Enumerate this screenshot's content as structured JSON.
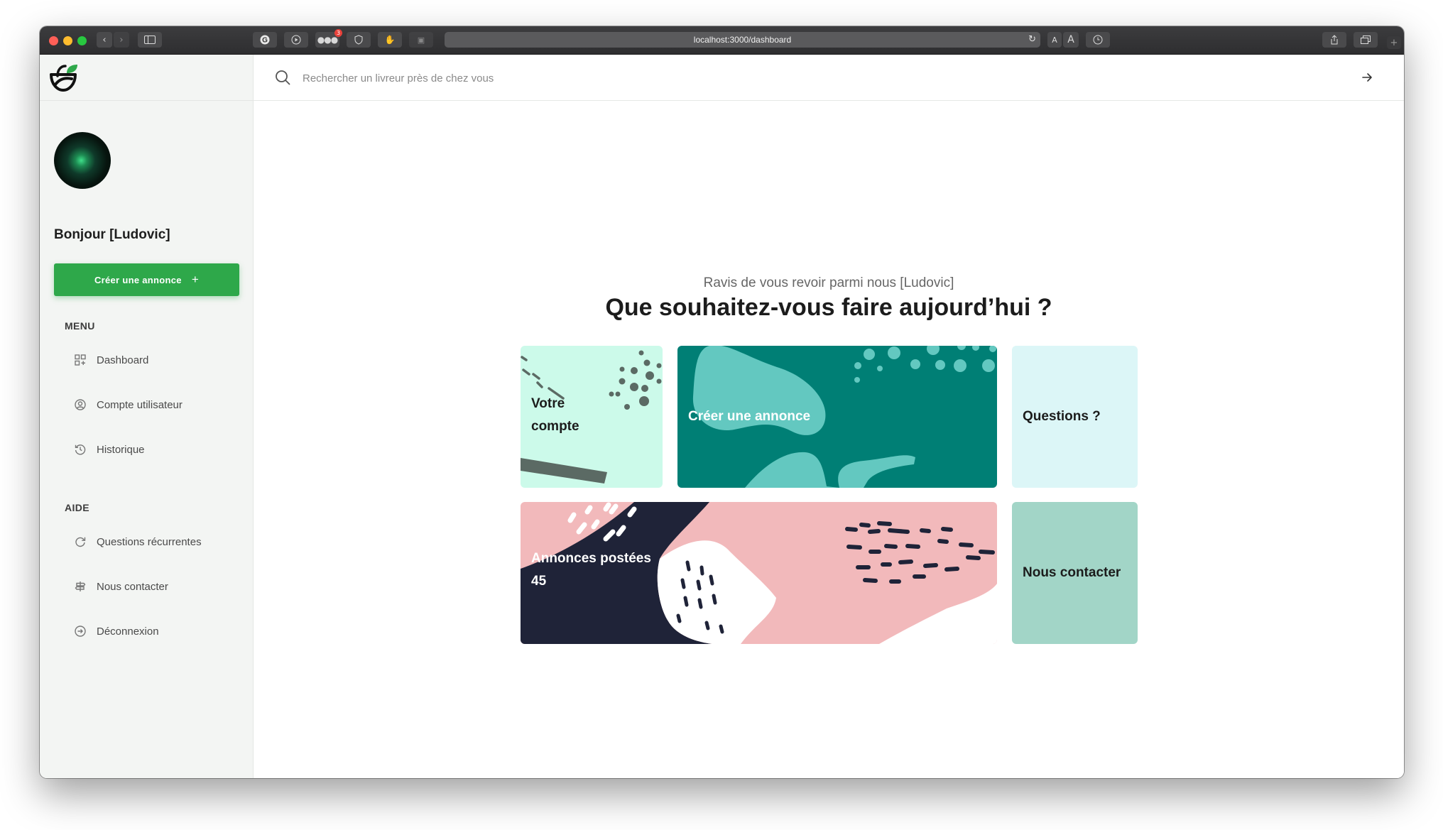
{
  "browser": {
    "url": "localhost:3000/dashboard",
    "extension_badge": "3",
    "reader_small": "A",
    "reader_large": "A"
  },
  "sidebar": {
    "greeting": "Bonjour [Ludovic]",
    "cta_label": "Créer une annonce",
    "cta_icon": "+",
    "menu_title": "MENU",
    "menu_items": [
      {
        "label": "Dashboard",
        "icon": "grid-icon"
      },
      {
        "label": "Compte utilisateur",
        "icon": "user-circle-icon"
      },
      {
        "label": "Historique",
        "icon": "history-icon"
      }
    ],
    "help_title": "AIDE",
    "help_items": [
      {
        "label": "Questions récurrentes",
        "icon": "refresh-question-icon"
      },
      {
        "label": "Nous contacter",
        "icon": "signpost-icon"
      },
      {
        "label": "Déconnexion",
        "icon": "logout-icon"
      }
    ]
  },
  "search": {
    "placeholder": "Rechercher un livreur près de chez vous"
  },
  "main": {
    "subtitle": "Ravis de vous revoir parmi nous [Ludovic]",
    "headline": "Que souhaitez-vous faire aujourd’hui ?"
  },
  "cards": {
    "account": {
      "line1": "Votre",
      "line2": "compte",
      "color": "#ccfaea"
    },
    "create": {
      "label": "Créer une annonce",
      "color": "#007f75"
    },
    "questions": {
      "label": "Questions ?",
      "color": "#dcf6f7"
    },
    "posted": {
      "label": "Annonces postées",
      "count": "45",
      "color": "#f2b9bb"
    },
    "contact": {
      "label": "Nous contacter",
      "color": "#a2d5c7"
    }
  },
  "colors": {
    "accent_green": "#2ea84a",
    "dark_navy": "#1f2338"
  }
}
